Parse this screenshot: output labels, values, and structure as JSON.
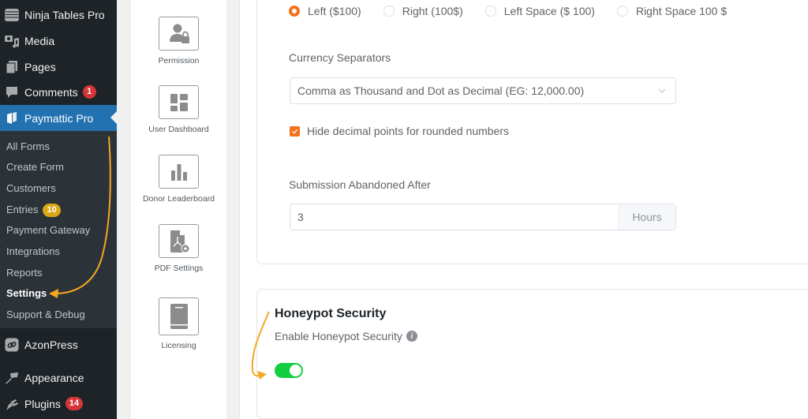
{
  "sidebar": {
    "items": [
      {
        "label": "Ninja Tables Pro",
        "icon": "table-icon"
      },
      {
        "label": "Media",
        "icon": "media-icon"
      },
      {
        "label": "Pages",
        "icon": "pages-icon"
      },
      {
        "label": "Comments",
        "icon": "comment-icon",
        "badge": "1"
      },
      {
        "label": "Paymattic Pro",
        "icon": "paymattic-icon",
        "active": true
      }
    ],
    "submenu": [
      {
        "label": "All Forms"
      },
      {
        "label": "Create Form"
      },
      {
        "label": "Customers"
      },
      {
        "label": "Entries",
        "badge": "10"
      },
      {
        "label": "Payment Gateway"
      },
      {
        "label": "Integrations"
      },
      {
        "label": "Reports"
      },
      {
        "label": "Settings",
        "current": true
      },
      {
        "label": "Support & Debug"
      }
    ],
    "items_after": [
      {
        "label": "AzonPress",
        "icon": "link-icon"
      },
      {
        "label": "Appearance",
        "icon": "brush-icon"
      },
      {
        "label": "Plugins",
        "icon": "plug-icon",
        "badge": "14"
      }
    ]
  },
  "settings_nav": [
    {
      "label": "Permission",
      "icon": "user-lock-icon"
    },
    {
      "label": "User Dashboard",
      "icon": "dashboard-icon"
    },
    {
      "label": "Donor Leaderboard",
      "icon": "bar-chart-icon"
    },
    {
      "label": "PDF Settings",
      "icon": "pdf-settings-icon"
    },
    {
      "label": "Licensing",
      "icon": "book-icon"
    }
  ],
  "currency_position": {
    "options": [
      "Left ($100)",
      "Right (100$)",
      "Left Space ($ 100)",
      "Right Space 100 $"
    ],
    "selected": "Left ($100)"
  },
  "currency_separators": {
    "label": "Currency Separators",
    "value": "Comma as Thousand and Dot as Decimal (EG: 12,000.00)"
  },
  "hide_decimal": {
    "label": "Hide decimal points for rounded numbers",
    "checked": true
  },
  "submission_abandoned": {
    "label": "Submission Abandoned After",
    "value": "3",
    "suffix": "Hours"
  },
  "honeypot": {
    "title": "Honeypot Security",
    "label": "Enable Honeypot Security",
    "info_icon": "i",
    "enabled": true
  },
  "colors": {
    "sidebar_bg": "#1d2327",
    "active_menu": "#2271b1",
    "accent_orange": "#f2711c",
    "toggle_on": "#13ce3f",
    "annotation_arrow": "#f5a623"
  }
}
